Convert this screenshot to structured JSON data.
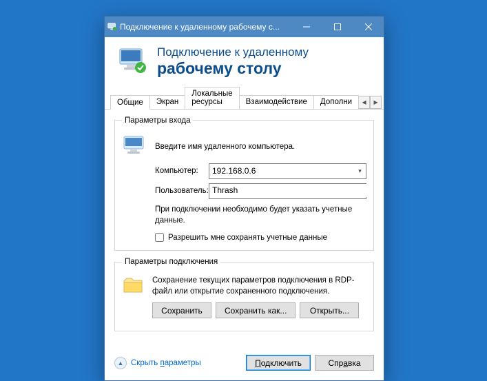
{
  "titlebar": {
    "title": "Подключение к удаленному рабочему с..."
  },
  "header": {
    "line1": "Подключение к удаленному",
    "line2": "рабочему столу"
  },
  "tabs": {
    "t0": "Общие",
    "t1": "Экран",
    "t2": "Локальные ресурсы",
    "t3": "Взаимодействие",
    "t4": "Дополни"
  },
  "login": {
    "legend": "Параметры входа",
    "instruction": "Введите имя удаленного компьютера.",
    "computer_label": "Компьютер:",
    "computer_value": "192.168.0.6",
    "user_label": "Пользователь:",
    "user_value": "Thrash",
    "note": "При подключении необходимо будет указать учетные данные.",
    "remember_label": "Разрешить мне сохранять учетные данные"
  },
  "conn": {
    "legend": "Параметры подключения",
    "text": "Сохранение текущих параметров подключения в RDP-файл или открытие сохраненного подключения.",
    "save": "Сохранить",
    "saveas": "Сохранить как...",
    "open": "Открыть..."
  },
  "footer": {
    "hide_pre": "Скрыть ",
    "hide_u": "п",
    "hide_post": "араметры",
    "connect_u": "П",
    "connect_post": "одключить",
    "help_pre": "Спр",
    "help_u": "а",
    "help_post": "вка"
  }
}
